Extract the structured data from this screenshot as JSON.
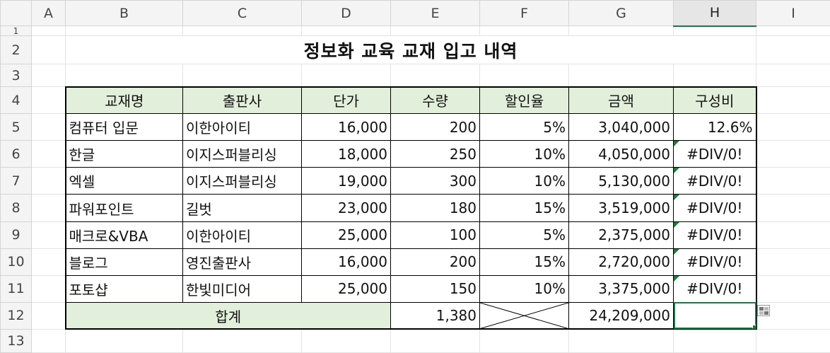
{
  "columns": [
    "A",
    "B",
    "C",
    "D",
    "E",
    "F",
    "G",
    "H",
    "I"
  ],
  "rows": [
    "1",
    "2",
    "3",
    "4",
    "5",
    "6",
    "7",
    "8",
    "9",
    "10",
    "11",
    "12",
    "13"
  ],
  "title": "정보화 교육 교재 입고 내역",
  "headers": {
    "name": "교재명",
    "publisher": "출판사",
    "price": "단가",
    "qty": "수량",
    "discount": "할인율",
    "amount": "금액",
    "share": "구성비"
  },
  "items": [
    {
      "name": "컴퓨터 입문",
      "publisher": "이한아이티",
      "price": "16,000",
      "qty": "200",
      "discount": "5%",
      "amount": "3,040,000",
      "share": "12.6%"
    },
    {
      "name": "한글",
      "publisher": "이지스퍼블리싱",
      "price": "18,000",
      "qty": "250",
      "discount": "10%",
      "amount": "4,050,000",
      "share": "#DIV/0!"
    },
    {
      "name": "엑셀",
      "publisher": "이지스퍼블리싱",
      "price": "19,000",
      "qty": "300",
      "discount": "10%",
      "amount": "5,130,000",
      "share": "#DIV/0!"
    },
    {
      "name": "파워포인트",
      "publisher": "길벗",
      "price": "23,000",
      "qty": "180",
      "discount": "15%",
      "amount": "3,519,000",
      "share": "#DIV/0!"
    },
    {
      "name": "매크로&VBA",
      "publisher": "이한아이티",
      "price": "25,000",
      "qty": "100",
      "discount": "5%",
      "amount": "2,375,000",
      "share": "#DIV/0!"
    },
    {
      "name": "블로그",
      "publisher": "영진출판사",
      "price": "16,000",
      "qty": "200",
      "discount": "15%",
      "amount": "2,720,000",
      "share": "#DIV/0!"
    },
    {
      "name": "포토샵",
      "publisher": "한빛미디어",
      "price": "25,000",
      "qty": "150",
      "discount": "10%",
      "amount": "3,375,000",
      "share": "#DIV/0!"
    }
  ],
  "total": {
    "label": "합계",
    "qty": "1,380",
    "amount": "24,209,000",
    "share": ""
  },
  "active_column": "H",
  "icons": {
    "quick_analysis": "quick-analysis-icon",
    "error": "error-indicator-icon"
  },
  "colors": {
    "header_fill": "#e2efda",
    "selection": "#217346"
  }
}
